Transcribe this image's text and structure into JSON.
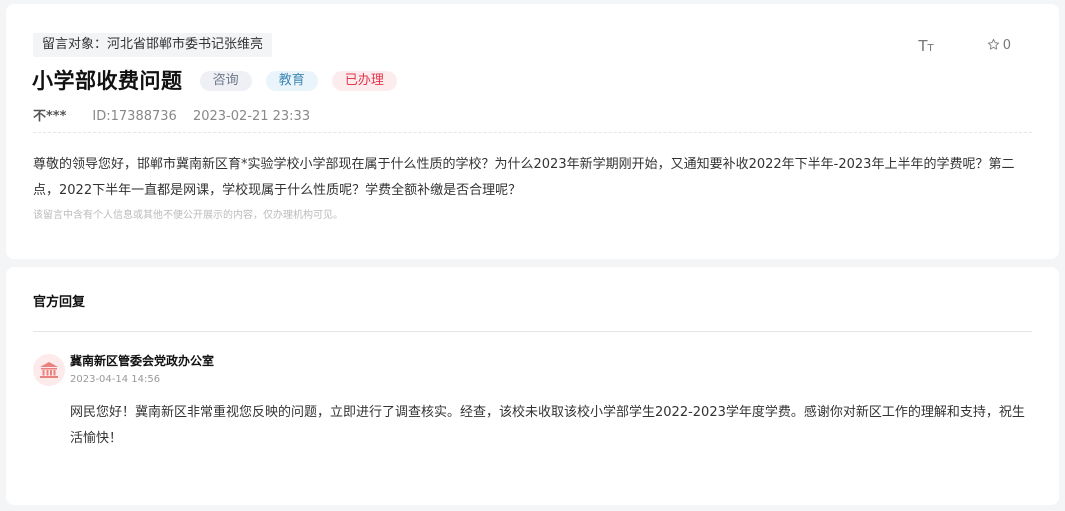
{
  "message": {
    "target_label": "留言对象：河北省邯郸市委书记张维亮",
    "title": "小学部收费问题",
    "tags": [
      "咨询",
      "教育",
      "已办理"
    ],
    "author": "不***",
    "id_text": "ID:17388736",
    "datetime": "2023-02-21 23:33",
    "body": "尊敬的领导您好，邯郸市冀南新区育*实验学校小学部现在属于什么性质的学校？为什么2023年新学期刚开始，又通知要补收2022年下半年-2023年上半年的学费呢？第二点，2022下半年一直都是网课，学校现属于什么性质呢？学费全额补缴是否合理呢？",
    "privacy_notice": "该留言中含有个人信息或其他不便公开展示的内容，仅办理机构可见。"
  },
  "toolbar": {
    "font_size_icon": "font-size-icon",
    "favorite_icon": "star-outline-icon",
    "favorite_count": "0"
  },
  "reply": {
    "section_title": "官方回复",
    "avatar_icon": "government-building-icon",
    "org_name": "冀南新区管委会党政办公室",
    "datetime": "2023-04-14 14:56",
    "body": "网民您好！冀南新区非常重视您反映的问题，立即进行了调查核实。经查，该校未收取该校小学部学生2022-2023学年度学费。感谢你对新区工作的理解和支持，祝生活愉快！"
  },
  "colors": {
    "page_bg": "#f4f5f7",
    "badge_consult": "#6f7889",
    "badge_education": "#3f88b5",
    "badge_done": "#e5364c",
    "avatar_accent": "#e9827f"
  }
}
